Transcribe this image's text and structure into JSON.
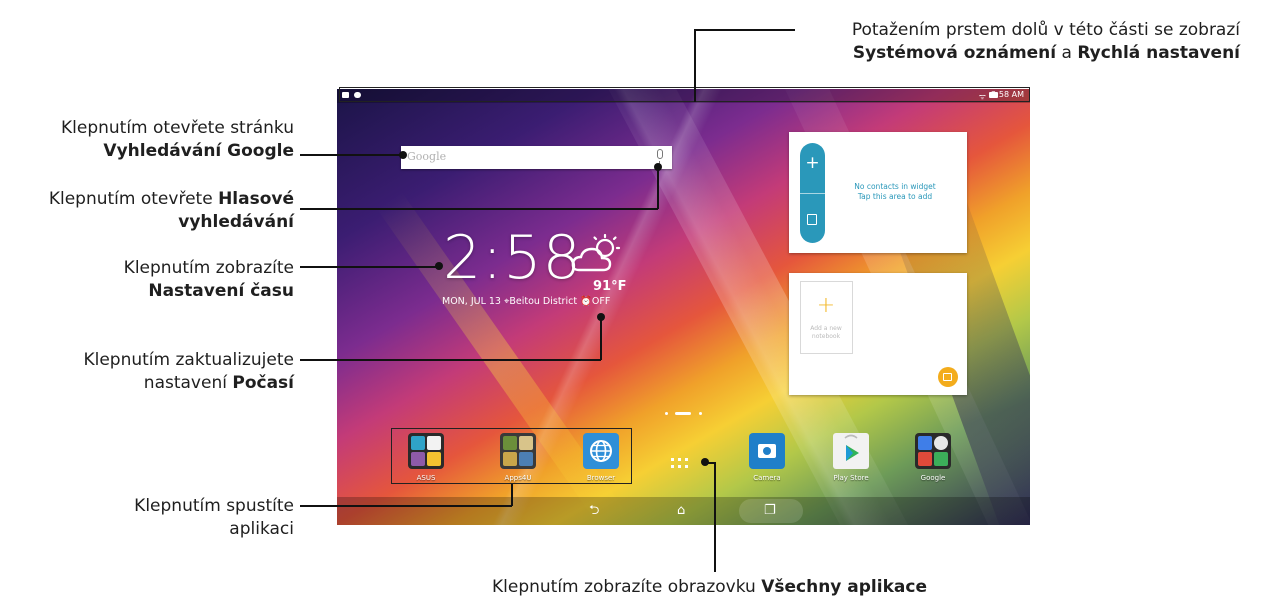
{
  "callouts": {
    "status_bar": {
      "line1": "Potažením prstem dolů v této části se zobrazí",
      "line2_bold1": "Systémová oznámení",
      "line2_mid": " a ",
      "line2_bold2": "Rychlá nastavení"
    },
    "google_search": {
      "line1": "Klepnutím otevřete stránku",
      "bold": "Vyhledávání Google"
    },
    "voice_search": {
      "prefix": "Klepnutím otevřete ",
      "bold1": "Hlasové",
      "bold2": "vyhledávání"
    },
    "time_settings": {
      "line1": "Klepnutím zobrazíte",
      "bold": "Nastavení času"
    },
    "weather": {
      "line1": "Klepnutím zaktualizujete",
      "prefix2": "nastavení ",
      "bold": "Počasí"
    },
    "launch_app": {
      "line1": "Klepnutím spustíte",
      "line2": "aplikaci"
    },
    "all_apps": {
      "prefix": "Klepnutím zobrazíte obrazovku ",
      "bold": "Všechny aplikace"
    }
  },
  "status_bar": {
    "time": "2:58 AM"
  },
  "search_widget": {
    "placeholder": "Google"
  },
  "clock_widget": {
    "time": "2:58",
    "temperature": "91°F",
    "date_line": "MON, JUL 13 ⌖Beitou District ⏰OFF",
    "weather_icon": "partly-cloudy-icon"
  },
  "contacts_widget": {
    "line1": "No contacts in widget",
    "line2": "Tap this area to add"
  },
  "notebook_widget": {
    "line1": "Add a new",
    "line2": "notebook"
  },
  "dock": {
    "asus": "ASUS",
    "apps4u": "Apps4U",
    "browser": "Browser",
    "camera": "Camera",
    "play_store": "Play Store",
    "google": "Google"
  },
  "colors": {
    "accent_blue": "#2a98ba",
    "accent_yellow": "#f3b82b"
  }
}
